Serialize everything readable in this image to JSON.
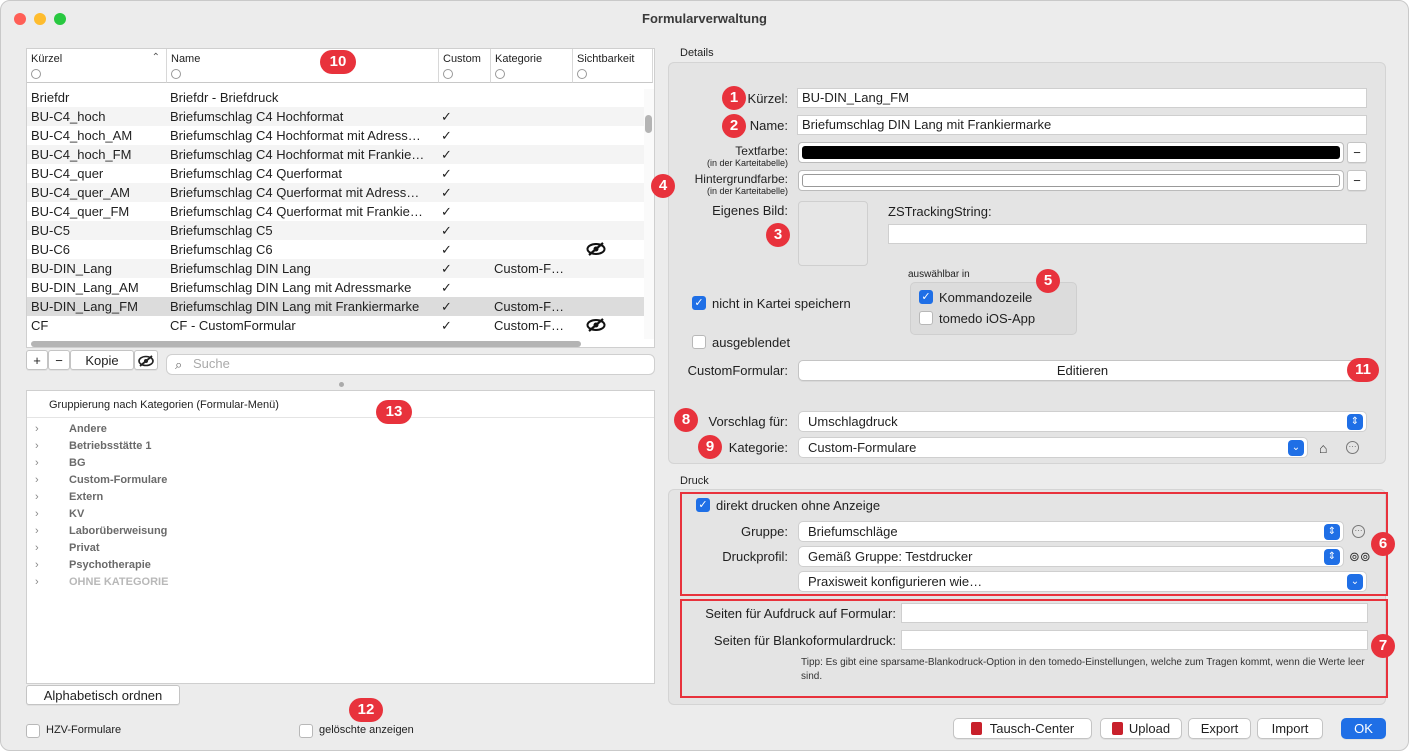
{
  "window": {
    "title": "Formularverwaltung"
  },
  "table": {
    "headers": [
      "Kürzel",
      "Name",
      "Custom",
      "Kategorie",
      "Sichtbarkeit"
    ],
    "partial_row": "Briefdr … Briefdruck (…)",
    "rows": [
      {
        "kuerzel": "Briefdr",
        "name": "Briefdr - Briefdruck",
        "custom": "",
        "kategorie": "",
        "hidden": false
      },
      {
        "kuerzel": "BU-C4_hoch",
        "name": "Briefumschlag C4 Hochformat",
        "custom": "✓",
        "kategorie": "",
        "hidden": false
      },
      {
        "kuerzel": "BU-C4_hoch_AM",
        "name": "Briefumschlag C4 Hochformat mit Adress…",
        "custom": "✓",
        "kategorie": "",
        "hidden": false
      },
      {
        "kuerzel": "BU-C4_hoch_FM",
        "name": "Briefumschlag C4 Hochformat mit Frankie…",
        "custom": "✓",
        "kategorie": "",
        "hidden": false
      },
      {
        "kuerzel": "BU-C4_quer",
        "name": "Briefumschlag C4 Querformat",
        "custom": "✓",
        "kategorie": "",
        "hidden": false
      },
      {
        "kuerzel": "BU-C4_quer_AM",
        "name": "Briefumschlag C4 Querformat mit Adress…",
        "custom": "✓",
        "kategorie": "",
        "hidden": false
      },
      {
        "kuerzel": "BU-C4_quer_FM",
        "name": "Briefumschlag C4 Querformat mit Frankie…",
        "custom": "✓",
        "kategorie": "",
        "hidden": false
      },
      {
        "kuerzel": "BU-C5",
        "name": "Briefumschlag C5",
        "custom": "✓",
        "kategorie": "",
        "hidden": false
      },
      {
        "kuerzel": "BU-C6",
        "name": "Briefumschlag C6",
        "custom": "✓",
        "kategorie": "",
        "hidden": true
      },
      {
        "kuerzel": "BU-DIN_Lang",
        "name": "Briefumschlag DIN Lang",
        "custom": "✓",
        "kategorie": "Custom-F…",
        "hidden": false
      },
      {
        "kuerzel": "BU-DIN_Lang_AM",
        "name": "Briefumschlag DIN Lang mit Adressmarke",
        "custom": "✓",
        "kategorie": "",
        "hidden": false
      },
      {
        "kuerzel": "BU-DIN_Lang_FM",
        "name": "Briefumschlag DIN Lang mit Frankiermarke",
        "custom": "✓",
        "kategorie": "Custom-F…",
        "hidden": false
      },
      {
        "kuerzel": "CF",
        "name": "CF - CustomFormular",
        "custom": "✓",
        "kategorie": "Custom-F…",
        "hidden": true
      }
    ]
  },
  "toolbar": {
    "plus": "+",
    "minus": "−",
    "kopie": "Kopie",
    "search_placeholder": "Suche"
  },
  "tree": {
    "header": "Gruppierung nach Kategorien (Formular-Menü)",
    "items": [
      "Andere",
      "Betriebsstätte 1",
      "BG",
      "Custom-Formulare",
      "Extern",
      "KV",
      "Laborüberweisung",
      "Privat",
      "Psychotherapie",
      "OHNE KATEGORIE"
    ]
  },
  "bottom_left": {
    "alpha_button": "Alphabetisch ordnen",
    "hzv": "HZV-Formulare",
    "deleted": "gelöschte anzeigen"
  },
  "details": {
    "section": "Details",
    "kuerzel_label": "Kürzel:",
    "kuerzel_value": "BU-DIN_Lang_FM",
    "name_label": "Name:",
    "name_value": "Briefumschlag DIN Lang mit Frankiermarke",
    "textfarbe_label": "Textfarbe:",
    "textfarbe_sub": "(in der Karteitabelle)",
    "hintergrund_label": "Hintergrundfarbe:",
    "hintergrund_sub": "(in der Karteitabelle)",
    "minus": "−",
    "bild_label": "Eigenes Bild:",
    "zs_label": "ZSTrackingString:",
    "auswahl_label": "auswählbar in",
    "kommandozeile": "Kommandozeile",
    "ios": "tomedo iOS-App",
    "nicht_kartei": "nicht in Kartei speichern",
    "ausgeblendet": "ausgeblendet",
    "custom_label": "CustomFormular:",
    "editieren": "Editieren",
    "vorschlag_label": "Vorschlag für:",
    "vorschlag_value": "Umschlagdruck",
    "kategorie_label": "Kategorie:",
    "kategorie_value": "Custom-Formulare"
  },
  "druck": {
    "section": "Druck",
    "direkt": "direkt drucken ohne Anzeige",
    "gruppe_label": "Gruppe:",
    "gruppe_value": "Briefumschläge",
    "profil_label": "Druckprofil:",
    "profil_value": "Gemäß Gruppe: Testdrucker",
    "praxis_value": "Praxisweit konfigurieren wie…",
    "aufdruck_label": "Seiten für Aufdruck auf Formular:",
    "blanko_label": "Seiten für Blankoformulardruck:",
    "tipp": "Tipp: Es gibt eine sparsame-Blankodruck-Option in den tomedo-Einstellungen, welche zum Tragen kommt, wenn die Werte leer sind."
  },
  "footer": {
    "tausch": "Tausch-Center",
    "upload": "Upload",
    "export": "Export",
    "import": "Import",
    "ok": "OK"
  },
  "badges": [
    "1",
    "2",
    "3",
    "4",
    "5",
    "6",
    "7",
    "8",
    "9",
    "10",
    "11",
    "12",
    "13"
  ],
  "colors": {
    "accent": "#1f6fe6",
    "badge": "#e8323c"
  }
}
